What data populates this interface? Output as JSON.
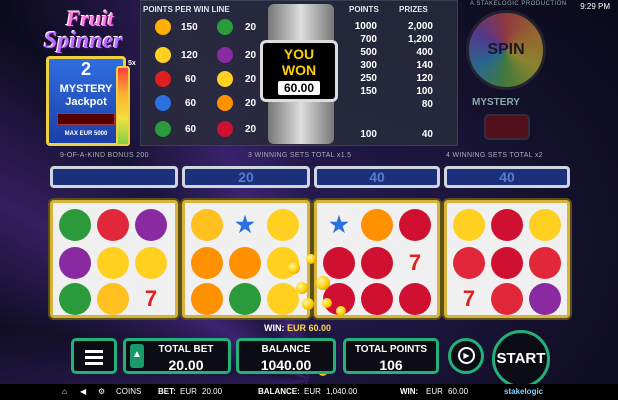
{
  "header": {
    "producer": "A STAKELOGIC PRODUCTION",
    "clock": "9:29 PM"
  },
  "logo": {
    "line1": "Fruit",
    "line2": "Spinner"
  },
  "jackpot": {
    "count": "2",
    "label_1": "MYSTERY",
    "label_2": "Jackpot",
    "amount": "",
    "max": "MAX EUR 5000",
    "multiplier": "5x"
  },
  "paytable": {
    "header_points": "POINTS PER WIN LINE",
    "header_points2": "POINTS",
    "header_prizes": "PRIZES",
    "left_values": [
      "150",
      "120",
      "60",
      "60",
      "60"
    ],
    "mid_values": [
      "20",
      "20",
      "20",
      "20",
      "20"
    ],
    "points": [
      "1000",
      "700",
      "500",
      "300",
      "250",
      "150",
      "",
      "100"
    ],
    "prizes": [
      "2,000",
      "1,200",
      "400",
      "140",
      "120",
      "100",
      "80",
      "40"
    ]
  },
  "you_won": {
    "line1": "YOU",
    "line2": "WON",
    "amount": "60.00"
  },
  "spin": {
    "label": "SPIN"
  },
  "mystery": {
    "label": "MYSTERY"
  },
  "bonus": {
    "b1": "9-OF-A-KIND BONUS 200",
    "b2": "3 WINNING SETS TOTAL x1.5",
    "b3": "4 WINNING SETS TOTAL x2"
  },
  "bars": {
    "v1": "",
    "v2": "20",
    "v3": "40",
    "v4": "40"
  },
  "win": {
    "label": "WIN:",
    "amount": "EUR 60.00"
  },
  "controls": {
    "total_bet_label": "TOTAL BET",
    "total_bet": "20.00",
    "balance_label": "BALANCE",
    "balance": "1040.00",
    "total_points_label": "TOTAL POINTS",
    "total_points": "106",
    "start": "START"
  },
  "footer": {
    "coins": "COINS",
    "bet_label": "BET:",
    "bet_currency": "EUR",
    "bet": "20.00",
    "balance_label": "BALANCE:",
    "balance_currency": "EUR",
    "balance": "1,040.00",
    "win_label": "WIN:",
    "win_currency": "EUR",
    "win": "60.00",
    "brand": "stakelogic"
  },
  "colors": {
    "reel_border": "#d8b23a",
    "control_accent": "#23b07a",
    "bar_fill": "#1c2f7a"
  }
}
